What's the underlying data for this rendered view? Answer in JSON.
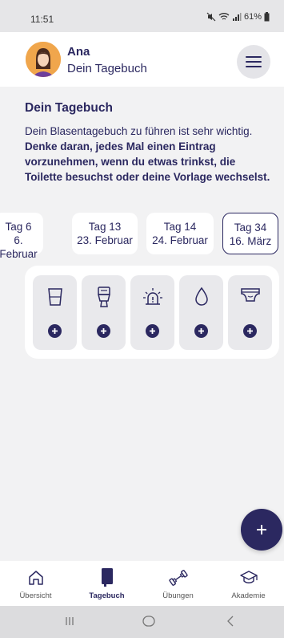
{
  "status": {
    "time": "11:51",
    "battery": "61%"
  },
  "header": {
    "user_name": "Ana",
    "subtitle": "Dein Tagebuch"
  },
  "intro": {
    "title": "Dein Tagebuch",
    "text": "Dein Blasentagebuch zu führen ist sehr wichtig.",
    "bold_text": "Denke daran, jedes Mal einen Eintrag vorzunehmen, wenn du etwas trinkst, die Toilette besuchst oder deine Vorlage wechselst."
  },
  "days": [
    {
      "label": "Tag 6",
      "date": "6. Februar"
    },
    {
      "label": "Tag 13",
      "date": "23. Februar"
    },
    {
      "label": "Tag 14",
      "date": "24. Februar"
    },
    {
      "label": "Tag 34",
      "date": "16. März",
      "selected": true
    }
  ],
  "entry_types": [
    {
      "icon": "glass-icon"
    },
    {
      "icon": "toilet-icon"
    },
    {
      "icon": "alarm-icon"
    },
    {
      "icon": "drop-icon"
    },
    {
      "icon": "diaper-icon"
    }
  ],
  "nav": {
    "items": [
      {
        "label": "Übersicht",
        "icon": "home-icon"
      },
      {
        "label": "Tagebuch",
        "icon": "diary-icon",
        "active": true
      },
      {
        "label": "Übungen",
        "icon": "dumbbell-icon"
      },
      {
        "label": "Akademie",
        "icon": "graduation-cap-icon"
      }
    ]
  },
  "colors": {
    "primary": "#2b2860",
    "background": "#f2f2f3",
    "avatar": "#f0a64c"
  }
}
